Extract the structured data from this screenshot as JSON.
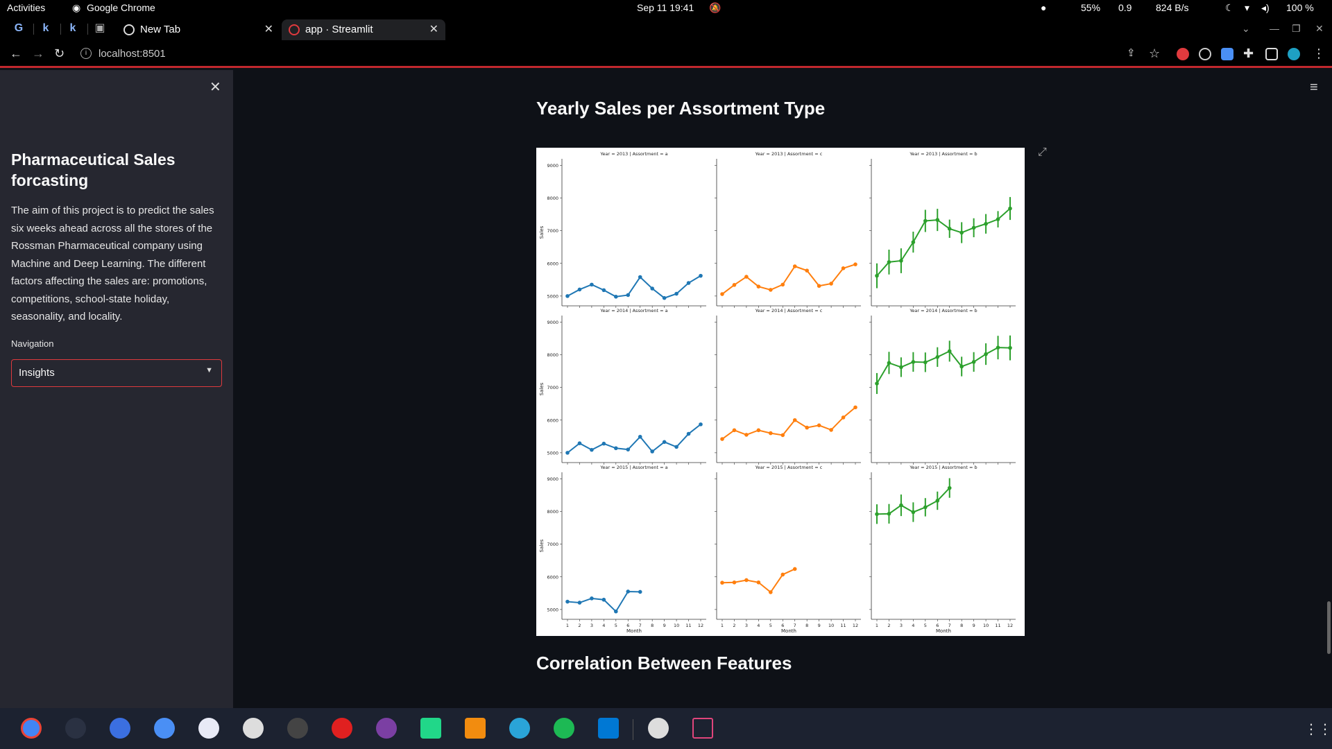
{
  "os_bar": {
    "activities": "Activities",
    "app_name": "Google Chrome",
    "datetime": "Sep 11  19:41",
    "battery_cpu": "55%",
    "load": "0.9",
    "network": "824 B/s",
    "volume": "100 %"
  },
  "browser": {
    "pinned_tabs": [
      "G",
      "k",
      "k",
      "▣"
    ],
    "tabs": [
      {
        "title": "New Tab",
        "active": false
      },
      {
        "title": "app · Streamlit",
        "active": true
      }
    ],
    "new_tab_label": "+",
    "url": "localhost:8501"
  },
  "sidebar": {
    "close_label": "✕",
    "title": "Pharmaceutical Sales forcasting",
    "description": "The aim of this project is to predict the sales six weeks ahead across all the stores of the Rossman Pharmaceutical company using Machine and Deep Learning. The different factors affecting the sales are: promotions, competitions, school-state holiday, seasonality, and locality.",
    "nav_label": "Navigation",
    "nav_value": "Insights"
  },
  "main": {
    "section1_title": "Yearly Sales per Assortment Type",
    "section2_title": "Correlation Between Features"
  },
  "colors": {
    "a": "#1f77b4",
    "c": "#ff7f0e",
    "b": "#2ca02c"
  },
  "chart_data": {
    "type": "line",
    "facet_rows": [
      "Year = 2013",
      "Year = 2014",
      "Year = 2015"
    ],
    "facet_cols": [
      "Assortment = a",
      "Assortment = c",
      "Assortment = b"
    ],
    "xlabel": "Month",
    "ylabel": "Sales",
    "x": [
      1,
      2,
      3,
      4,
      5,
      6,
      7,
      8,
      9,
      10,
      11,
      12
    ],
    "ylim": [
      4700,
      9200
    ],
    "yticks": [
      5000,
      6000,
      7000,
      8000,
      9000
    ],
    "panels": [
      {
        "title": "Year = 2013 | Assortment = a",
        "values": [
          5000,
          5200,
          5350,
          5180,
          4980,
          5030,
          5580,
          5230,
          4940,
          5070,
          5400,
          5620
        ]
      },
      {
        "title": "Year = 2013 | Assortment = c",
        "values": [
          5060,
          5340,
          5590,
          5290,
          5190,
          5350,
          5910,
          5780,
          5310,
          5380,
          5850,
          5970
        ]
      },
      {
        "title": "Year = 2013 | Assortment = b",
        "values": [
          5620,
          6040,
          6080,
          6650,
          7300,
          7330,
          7060,
          6940,
          7090,
          7210,
          7350,
          7680
        ],
        "err": [
          380,
          380,
          380,
          320,
          340,
          340,
          280,
          320,
          290,
          300,
          250,
          350
        ]
      },
      {
        "title": "Year = 2014 | Assortment = a",
        "values": [
          5000,
          5290,
          5090,
          5280,
          5140,
          5100,
          5490,
          5040,
          5330,
          5180,
          5580,
          5870
        ]
      },
      {
        "title": "Year = 2014 | Assortment = c",
        "values": [
          5420,
          5690,
          5550,
          5690,
          5600,
          5540,
          6000,
          5770,
          5840,
          5700,
          6080,
          6390
        ]
      },
      {
        "title": "Year = 2014 | Assortment = b",
        "values": [
          7120,
          7750,
          7620,
          7780,
          7770,
          7930,
          8110,
          7640,
          7780,
          8020,
          8220,
          8210
        ],
        "err": [
          320,
          340,
          300,
          300,
          300,
          300,
          320,
          300,
          300,
          330,
          360,
          380
        ]
      },
      {
        "title": "Year = 2015 | Assortment = a",
        "values": [
          5240,
          5210,
          5340,
          5300,
          4940,
          5550,
          5540
        ]
      },
      {
        "title": "Year = 2015 | Assortment = c",
        "values": [
          5820,
          5830,
          5900,
          5830,
          5530,
          6070,
          6240
        ]
      },
      {
        "title": "Year = 2015 | Assortment = b",
        "values": [
          7920,
          7930,
          8190,
          7980,
          8130,
          8330,
          8720
        ],
        "err": [
          300,
          300,
          330,
          300,
          280,
          280,
          300
        ]
      }
    ]
  }
}
